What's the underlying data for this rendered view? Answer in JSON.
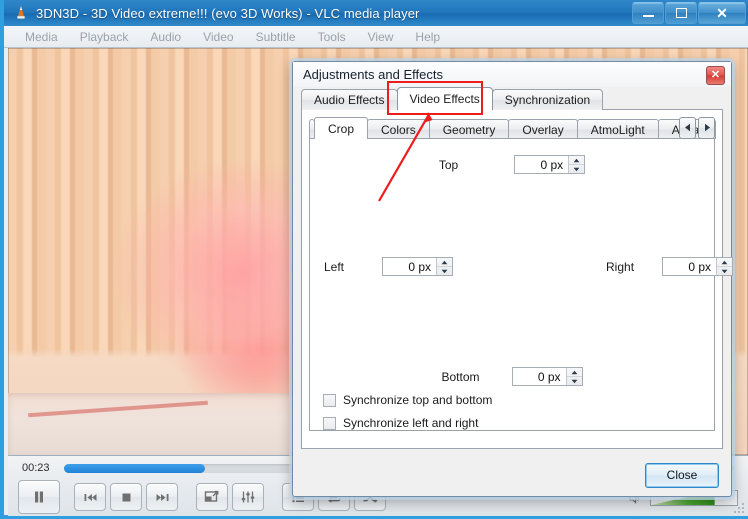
{
  "window": {
    "title": "3DN3D - 3D Video extreme!!! (evo 3D Works) - VLC media player",
    "app_icon": "vlc-cone-icon",
    "buttons": {
      "minimize": "minimize-icon",
      "maximize": "maximize-icon",
      "close": "close-icon"
    },
    "titlebar_color": "#2277bd",
    "border_color": "#2f9fe0"
  },
  "menubar": {
    "items": [
      {
        "label": "Media"
      },
      {
        "label": "Playback"
      },
      {
        "label": "Audio"
      },
      {
        "label": "Video"
      },
      {
        "label": "Subtitle"
      },
      {
        "label": "Tools"
      },
      {
        "label": "View"
      },
      {
        "label": "Help"
      }
    ]
  },
  "player": {
    "elapsed": "00:23",
    "seek_percent": 21,
    "volume_percent": 74,
    "controls": [
      {
        "name": "play-pause-button",
        "icon": "pause-icon"
      },
      {
        "name": "previous-button",
        "icon": "previous-icon"
      },
      {
        "name": "stop-button",
        "icon": "stop-icon"
      },
      {
        "name": "next-button",
        "icon": "next-icon"
      },
      {
        "name": "fullscreen-button",
        "icon": "fullscreen-icon"
      },
      {
        "name": "equalizer-button",
        "icon": "equalizer-icon"
      },
      {
        "name": "playlist-button",
        "icon": "playlist-icon"
      },
      {
        "name": "loop-button",
        "icon": "loop-icon"
      },
      {
        "name": "shuffle-button",
        "icon": "shuffle-icon"
      }
    ]
  },
  "dialog": {
    "title": "Adjustments and Effects",
    "close_icon": "close-icon",
    "outer_tabs": [
      {
        "label": "Audio Effects",
        "active": false
      },
      {
        "label": "Video Effects",
        "active": true
      },
      {
        "label": "Synchronization",
        "active": false
      }
    ],
    "inner_tabs": [
      {
        "label": "Crop",
        "active": true
      },
      {
        "label": "Colors",
        "active": false
      },
      {
        "label": "Geometry",
        "active": false
      },
      {
        "label": "Overlay",
        "active": false
      },
      {
        "label": "AtmoLight",
        "active": false
      },
      {
        "label": "Advanced",
        "active": false
      }
    ],
    "tab_scroll_left": "chevron-left-icon",
    "tab_scroll_right": "chevron-right-icon",
    "crop": {
      "top": {
        "label": "Top",
        "value": "0 px"
      },
      "left": {
        "label": "Left",
        "value": "0 px"
      },
      "right": {
        "label": "Right",
        "value": "0 px"
      },
      "bottom": {
        "label": "Bottom",
        "value": "0 px"
      },
      "sync_top_bottom": {
        "label": "Synchronize top and bottom",
        "checked": false
      },
      "sync_left_right": {
        "label": "Synchronize left and right",
        "checked": false
      }
    },
    "footer": {
      "close_label": "Close"
    }
  },
  "annotation": {
    "highlight_color": "#ee1c1c",
    "arrow_color": "#ee1c1c",
    "target": "Video Effects"
  }
}
